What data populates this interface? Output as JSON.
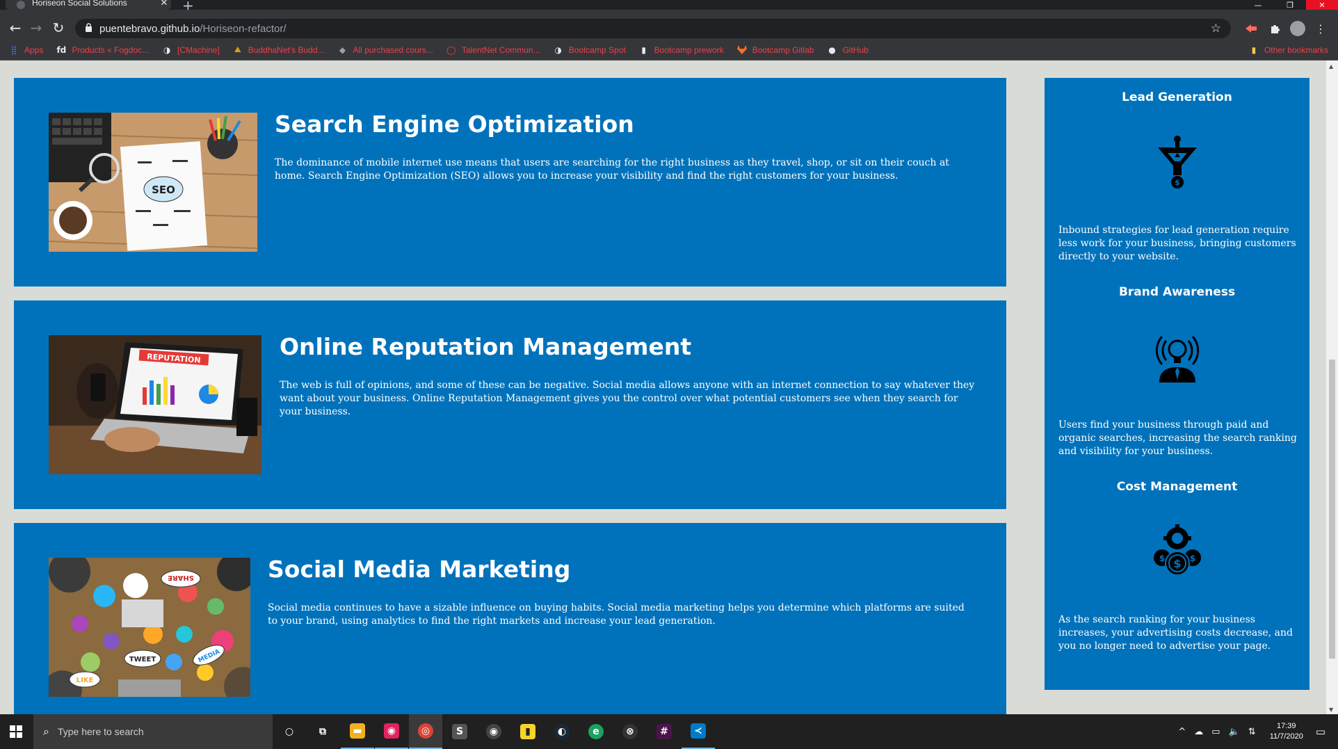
{
  "browser": {
    "tab_title": "Horiseon Social Solutions",
    "tab_close": "✕",
    "new_tab": "+",
    "url_host": "puentebravo.github.io",
    "url_path": "/Horiseon-refactor/",
    "window_controls": {
      "minimize": "—",
      "maximize": "❐",
      "close": "✕"
    },
    "icons": {
      "back": "←",
      "forward": "→",
      "reload": "↻",
      "lock": "🔒",
      "star": "☆",
      "menu": "⋮",
      "extension": "⬢",
      "puzzle": "✱"
    }
  },
  "bookmarks": {
    "items": [
      {
        "label": "Apps",
        "icon": "apps-grid-icon",
        "glyph": "⣿"
      },
      {
        "label": "Products « Fogdoc...",
        "icon": "fogdoc-icon",
        "glyph": "fd"
      },
      {
        "label": "[CMachine]",
        "icon": "cmachine-icon",
        "glyph": "◑"
      },
      {
        "label": "BuddhaNet's Budd...",
        "icon": "buddhanet-icon",
        "glyph": "⛰"
      },
      {
        "label": "All purchased cours...",
        "icon": "courses-icon",
        "glyph": "◆"
      },
      {
        "label": "TalentNet Commun...",
        "icon": "talentnet-icon",
        "glyph": "◯"
      },
      {
        "label": "Bootcamp Spot",
        "icon": "bootcamp-spot-icon",
        "glyph": "◑"
      },
      {
        "label": "Bootcamp prework",
        "icon": "bootcamp-prework-icon",
        "glyph": "▮"
      },
      {
        "label": "Bootcamp Gitlab",
        "icon": "gitlab-icon",
        "glyph": "🦊"
      },
      {
        "label": "GitHub",
        "icon": "github-icon",
        "glyph": "●"
      }
    ],
    "other": {
      "label": "Other bookmarks",
      "glyph": "▮"
    }
  },
  "services": [
    {
      "title": "Search Engine Optimization",
      "text": "The dominance of mobile internet use means that users are searching for the right business as they travel, shop, or sit on their couch at home. Search Engine Optimization (SEO) allows you to increase your visibility and find the right customers for your business.",
      "image_label": "SEO"
    },
    {
      "title": "Online Reputation Management",
      "text": "The web is full of opinions, and some of these can be negative. Social media allows anyone with an internet connection to say whatever they want about your business. Online Reputation Management gives you the control over what potential customers see when they search for your business.",
      "image_label": "REPUTATION"
    },
    {
      "title": "Social Media Marketing",
      "text": "Social media continues to have a sizable influence on buying habits. Social media marketing helps you determine which platforms are suited to your brand, using analytics to find the right markets and increase your lead generation.",
      "image_labels": [
        "SHARE",
        "TWEET",
        "LIKE",
        "MEDIA"
      ]
    }
  ],
  "benefits": [
    {
      "title": "Lead Generation",
      "icon": "lead-funnel-icon",
      "text": "Inbound strategies for lead generation require less work for your business, bringing customers directly to your website."
    },
    {
      "title": "Brand Awareness",
      "icon": "lightbulb-broadcast-icon",
      "text": "Users find your business through paid and organic searches, increasing the search ranking and visibility for your business."
    },
    {
      "title": "Cost Management",
      "icon": "gear-coins-icon",
      "text": "As the search ranking for your business increases, your advertising costs decrease, and you no longer need to advertise your page."
    }
  ],
  "taskbar": {
    "search_placeholder": "Type here to search",
    "time": "17:39",
    "date": "11/7/2020",
    "apps": [
      {
        "name": "cortana",
        "glyph": "○",
        "bg": "transparent"
      },
      {
        "name": "task-view",
        "glyph": "⧉",
        "bg": "transparent"
      },
      {
        "name": "file-explorer",
        "glyph": "▬",
        "bg": "#f2b01e"
      },
      {
        "name": "discord",
        "glyph": "◉",
        "bg": "#e0245e"
      },
      {
        "name": "chrome",
        "glyph": "◎",
        "bg": "#db4437"
      },
      {
        "name": "slack-s",
        "glyph": "S",
        "bg": "#555555"
      },
      {
        "name": "music",
        "glyph": "◉",
        "bg": "#444444"
      },
      {
        "name": "sticky-notes",
        "glyph": "▮",
        "bg": "#f6d42b"
      },
      {
        "name": "steam",
        "glyph": "◐",
        "bg": "#1b2838"
      },
      {
        "name": "edge",
        "glyph": "e",
        "bg": "#1aa260"
      },
      {
        "name": "xbox",
        "glyph": "⊗",
        "bg": "#333333"
      },
      {
        "name": "slack",
        "glyph": "#",
        "bg": "#4a154b"
      },
      {
        "name": "vscode",
        "glyph": "≺",
        "bg": "#007acc"
      }
    ],
    "tray": [
      "^",
      "☁",
      "▭",
      "🔈",
      "⇅"
    ]
  }
}
